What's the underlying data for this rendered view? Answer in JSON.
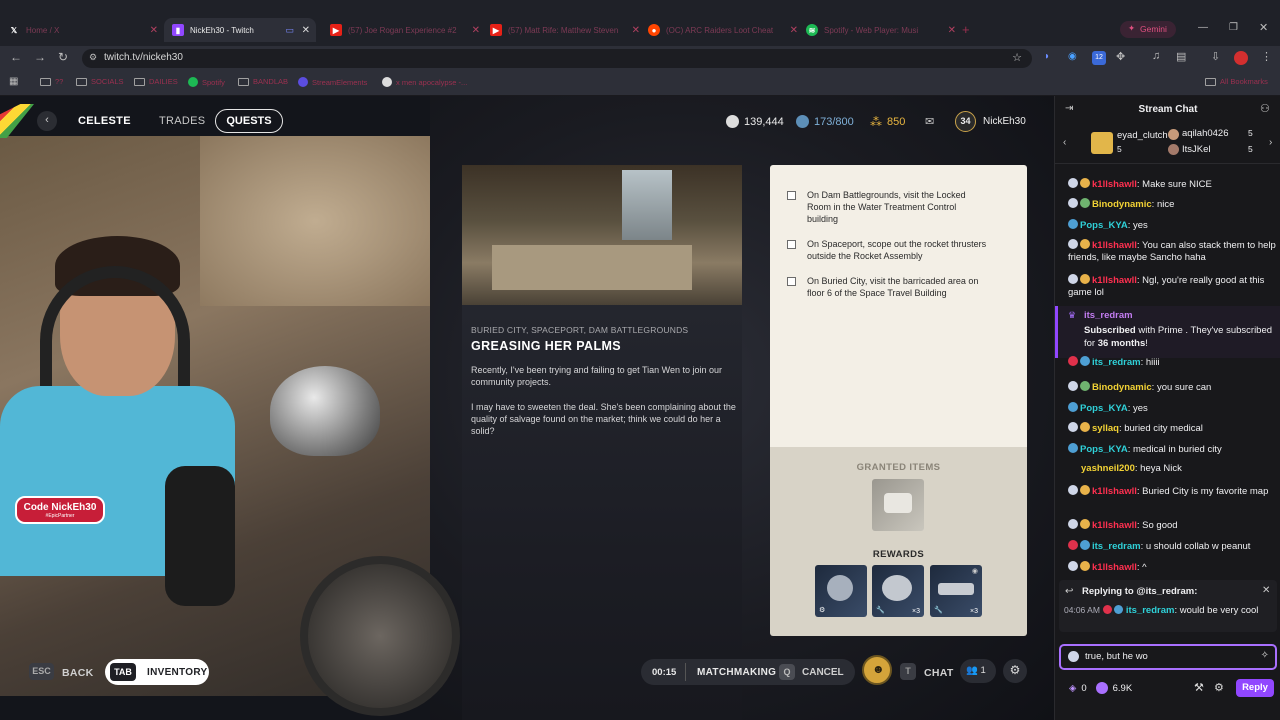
{
  "browser": {
    "tabs": [
      {
        "icon": "x-logo-icon",
        "label": "Home / X",
        "color": "#ffffff"
      },
      {
        "icon": "twitch-logo-icon",
        "label": "NickEh30 - Twitch",
        "active": true
      },
      {
        "icon": "youtube-logo-icon",
        "label": "(57) Joe Rogan Experience #2"
      },
      {
        "icon": "youtube-logo-icon",
        "label": "(57) Matt Rife: Matthew Steven"
      },
      {
        "icon": "reddit-logo-icon",
        "label": "(OC) ARC Raiders Loot Cheat"
      },
      {
        "icon": "spotify-logo-icon",
        "label": "Spotify - Web Player: Musi"
      }
    ],
    "gemini_label": "Gemini",
    "url": "twitch.tv/nickeh30",
    "bookmarks": [
      "??",
      "SOCIALS",
      "DAILIES",
      "Spotify",
      "BANDLAB",
      "StreamElements",
      "x men apocalypse -..."
    ],
    "all_bookmarks": "All Bookmarks",
    "extension_badge": "12"
  },
  "game": {
    "nav": {
      "celeste": "CELESTE",
      "trades": "TRADES",
      "quests": "QUESTS"
    },
    "stats": {
      "coins": "139,444",
      "capacity": "173/800",
      "tokens": "850",
      "level": "34",
      "player": "NickEh30"
    },
    "quest": {
      "locations": "BURIED CITY, SPACEPORT, DAM BATTLEGROUNDS",
      "title": "GREASING HER PALMS",
      "para1": "Recently, I've been trying and failing to get Tian Wen to join our community projects.",
      "para2": "I may have to sweeten the deal. She's been complaining about the quality of salvage found on the market; think we could do her a solid?"
    },
    "objectives": [
      "On Dam Battlegrounds, visit the Locked Room in the Water Treatment Control building",
      "On Spaceport, scope out the rocket thrusters outside the Rocket Assembly",
      "On Buried City, visit the barricaded area on floor 6 of the Space Travel Building"
    ],
    "granted_items_label": "GRANTED ITEMS",
    "rewards_label": "REWARDS",
    "reward_qty": [
      "",
      "×3",
      "×3"
    ],
    "bottom": {
      "esc_key": "ESC",
      "back": "BACK",
      "tab_key": "TAB",
      "inventory": "INVENTORY",
      "timer": "00:15",
      "matchmaking": "MATCHMAKING",
      "q_key": "Q",
      "cancel": "CANCEL",
      "t_key": "T",
      "chat": "CHAT",
      "party_count": "1"
    },
    "webcam_badge": {
      "code": "Code NickEh30",
      "sub": "#EpicPartner"
    }
  },
  "chat": {
    "title": "Stream Chat",
    "gifters": [
      {
        "name": "eyad_clutch",
        "count": "5"
      },
      {
        "name": "aqilah0426",
        "count": "5"
      },
      {
        "name": "ItsJKel",
        "count": "5"
      }
    ],
    "messages": [
      {
        "user": "k1llshawll",
        "color": "red",
        "text": "Make sure NICE"
      },
      {
        "user": "Binodynamic",
        "color": "yel",
        "text": "nice"
      },
      {
        "user": "Pops_KYA",
        "color": "cyan",
        "text": "yes"
      },
      {
        "user": "k1llshawll",
        "color": "red",
        "text": "You can also stack them to help friends, like maybe Sancho haha"
      },
      {
        "user": "k1llshawll",
        "color": "red",
        "text": "Ngl, you're really good at this game lol"
      }
    ],
    "sub": {
      "user": "its_redram",
      "line1": "Subscribed",
      "line2": "with Prime . They've subscribed for",
      "months": "36 months",
      "end": "!"
    },
    "messages2": [
      {
        "user": "its_redram",
        "color": "cyan",
        "text": "hiiii"
      },
      {
        "user": "Binodynamic",
        "color": "yel",
        "text": "you sure can"
      },
      {
        "user": "Pops_KYA",
        "color": "cyan",
        "text": "yes"
      },
      {
        "user": "syllaq",
        "color": "yel",
        "text": "buried city medical"
      },
      {
        "user": "Pops_KYA",
        "color": "cyan",
        "text": "medical in buried city"
      },
      {
        "user": "yashneil200",
        "color": "yel",
        "text": "heya Nick"
      },
      {
        "user": "k1llshawll",
        "color": "red",
        "text": "Buried City is my favorite map"
      },
      {
        "user": "k1llshawll",
        "color": "red",
        "text": "So good"
      },
      {
        "user": "its_redram",
        "color": "cyan",
        "text": "u should collab w peanut"
      },
      {
        "user": "k1llshawll",
        "color": "red",
        "text": "^"
      }
    ],
    "reply": {
      "label": "Replying to @its_redram:",
      "time": "04:06 AM",
      "user": "its_redram",
      "text": "would be very cool"
    },
    "input_value": "true, but he wo",
    "points": "0",
    "viewers": "6.9K",
    "reply_button": "Reply"
  }
}
